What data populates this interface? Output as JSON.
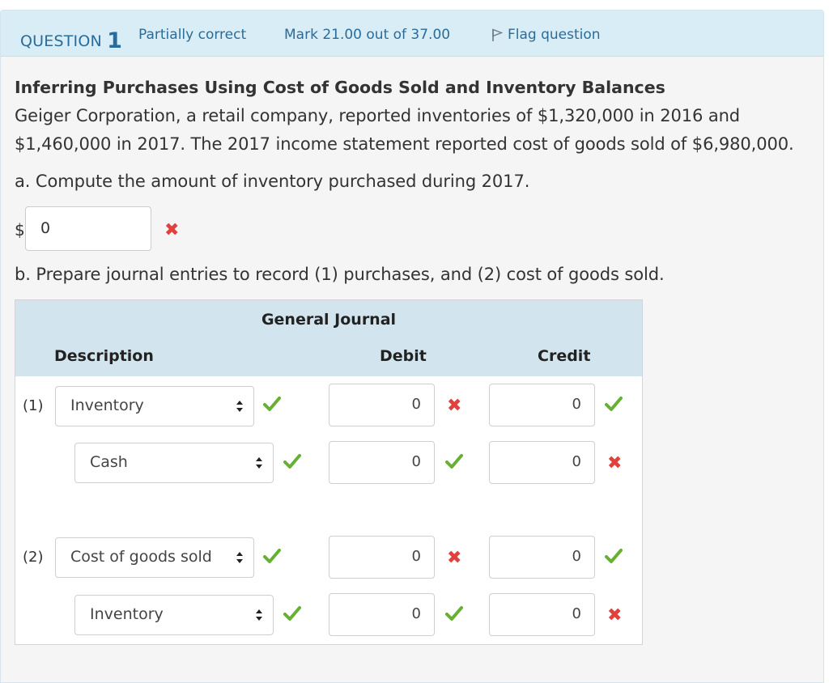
{
  "header": {
    "question_word": "QUESTION",
    "question_number": "1",
    "state": "Partially correct",
    "mark": "Mark 21.00 out of 37.00",
    "flag_label": "Flag question"
  },
  "question": {
    "title": "Inferring Purchases Using Cost of Goods Sold and Inventory Balances",
    "text_line1": "Geiger Corporation, a retail company, reported inventories of $1,320,000 in 2016 and",
    "text_line2": "$1,460,000 in 2017. The 2017 income statement reported cost of goods sold of $6,980,000.",
    "part_a": "a. Compute the amount of inventory purchased during 2017.",
    "part_a_currency": "$",
    "part_a_answer": "0",
    "part_b": "b. Prepare journal entries to record (1) purchases, and (2) cost of goods sold."
  },
  "journal": {
    "title": "General Journal",
    "col_description": "Description",
    "col_debit": "Debit",
    "col_credit": "Credit",
    "entries": [
      {
        "number": "(1)",
        "rows": [
          {
            "account": "Inventory",
            "account_status": "correct",
            "debit": "0",
            "debit_status": "incorrect",
            "credit": "0",
            "credit_status": "correct"
          },
          {
            "account": "Cash",
            "account_status": "correct",
            "debit": "0",
            "debit_status": "correct",
            "credit": "0",
            "credit_status": "incorrect"
          }
        ]
      },
      {
        "number": "(2)",
        "rows": [
          {
            "account": "Cost of goods sold",
            "account_status": "correct",
            "debit": "0",
            "debit_status": "incorrect",
            "credit": "0",
            "credit_status": "correct"
          },
          {
            "account": "Inventory",
            "account_status": "correct",
            "debit": "0",
            "debit_status": "correct",
            "credit": "0",
            "credit_status": "incorrect"
          }
        ]
      }
    ]
  },
  "colors": {
    "header_bg": "#d9edf7",
    "header_text": "#2a6c99",
    "correct": "#66b032",
    "incorrect": "#e0413d"
  },
  "icons": {
    "flag": "flag-icon",
    "correct": "checkmark-icon",
    "incorrect": "cross-icon",
    "select_arrows": "select-arrows-icon"
  }
}
